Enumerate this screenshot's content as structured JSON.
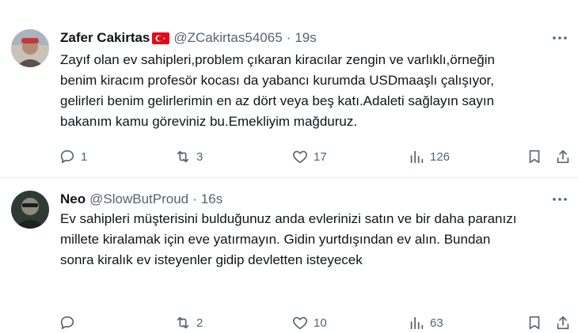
{
  "tweets": [
    {
      "name": "Zafer Cakirtas",
      "handle": "@ZCakirtas54065",
      "separator": "·",
      "time": "19s",
      "text": "Zayıf olan ev sahipleri,problem çıkaran kiracılar zengin ve varlıklı,örneğin\nbenim kiracım profesör kocası da yabancı kurumda USDmaaşlı çalışıyor,\ngelirleri benim gelirlerimin en az dört veya beş katı.Adaleti sağlayın sayın\nbakanım kamu göreviniz bu.Emekliyim mağduruz.",
      "replies": "1",
      "retweets": "3",
      "likes": "17",
      "views": "126",
      "flag": "turkey-flag",
      "colors": {
        "avatar_bg": "#8a7f72",
        "flag": "#e30a17"
      }
    },
    {
      "name": "Neo",
      "handle": "@SlowButProud",
      "separator": "·",
      "time": "16s",
      "text": "Ev sahipleri müşterisini bulduğunuz anda evlerinizi satın ve bir daha paranızı\nmillete kiralamak için eve yatırmayın. Gidin yurtdışından ev alın. Bundan\nsonra kiralık ev isteyenler gidip devletten isteyecek",
      "replies": "",
      "retweets": "2",
      "likes": "10",
      "views": "63",
      "colors": {
        "avatar_bg": "#3b4a3e"
      }
    }
  ],
  "icons": {
    "reply": "reply-icon",
    "retweet": "retweet-icon",
    "like": "heart-icon",
    "views": "views-icon",
    "bookmark": "bookmark-icon",
    "share": "share-icon",
    "more": "more-icon"
  },
  "colors": {
    "text": "#0f1419",
    "muted": "#536471",
    "divider": "#e6ecf0"
  }
}
